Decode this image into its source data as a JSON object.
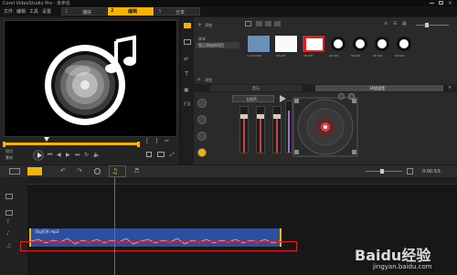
{
  "app": {
    "title": "Corel VideoStudio Pro - 未命名"
  },
  "menu": [
    "文件",
    "编辑",
    "工具",
    "设置"
  ],
  "steps": [
    {
      "num": "1",
      "label": "捕获",
      "active": false
    },
    {
      "num": "2",
      "label": "编辑",
      "active": true
    },
    {
      "num": "3",
      "label": "分享",
      "active": false
    }
  ],
  "player": {
    "project_label": "项目",
    "clip_label": "素材"
  },
  "library": {
    "add_label": "添加",
    "folders": [
      "样本",
      "您已添加的项目"
    ],
    "browse_label": "浏览",
    "thumbs": [
      {
        "label": "3.mp3 000"
      },
      {
        "label": "SP-V04"
      },
      {
        "label": "SP-V05"
      },
      {
        "label": "SP-S01"
      },
      {
        "label": "SP-S02"
      },
      {
        "label": "SP-S03"
      },
      {
        "label": "SP-S04"
      }
    ]
  },
  "options": {
    "tab_music": "音乐",
    "tab_mixer": "环绕混音",
    "mixer_label": "立体声"
  },
  "timeline": {
    "tooltip": "混音器",
    "timecode": "0:00:53:",
    "clip_label": "可以打开.mp3"
  },
  "watermark": {
    "brand": "Baidu经验",
    "url": "jingyan.baidu.com"
  },
  "colors": {
    "accent": "#f5b400",
    "audio_clip": "#2e4f9c",
    "highlight": "#e02020",
    "playhead": "#2f80c0"
  }
}
